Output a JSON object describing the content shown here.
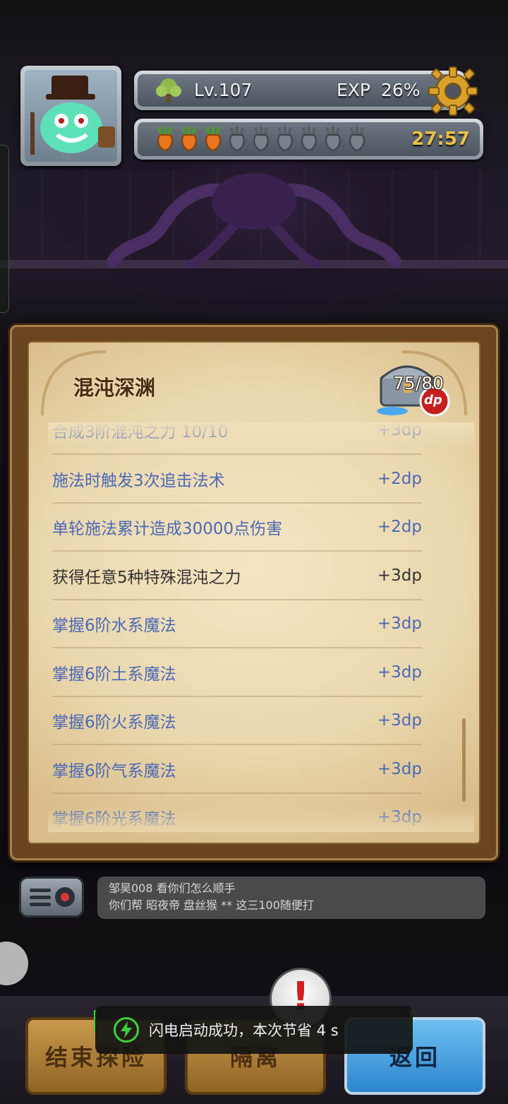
{
  "player": {
    "level": "Lv.107",
    "exp_label": "EXP",
    "exp_value": "26%",
    "stamina_total": 9,
    "stamina_filled": 3,
    "timer": "27:57"
  },
  "panel": {
    "title": "混沌深渊",
    "chest_count": "75/80",
    "chest_badge": "dp",
    "items": [
      {
        "name": "合成3阶混沌之力 10/10",
        "points": "+3dp",
        "done": false
      },
      {
        "name": "施法时触发3次追击法术",
        "points": "+2dp",
        "done": false
      },
      {
        "name": "单轮施法累计造成30000点伤害",
        "points": "+2dp",
        "done": false
      },
      {
        "name": "获得任意5种特殊混沌之力",
        "points": "+3dp",
        "done": true
      },
      {
        "name": "掌握6阶水系魔法",
        "points": "+3dp",
        "done": false
      },
      {
        "name": "掌握6阶土系魔法",
        "points": "+3dp",
        "done": false
      },
      {
        "name": "掌握6阶火系魔法",
        "points": "+3dp",
        "done": false
      },
      {
        "name": "掌握6阶气系魔法",
        "points": "+3dp",
        "done": false
      },
      {
        "name": "掌握6阶光系魔法",
        "points": "+3dp",
        "done": false
      }
    ]
  },
  "chat": {
    "sender": "邹昊008",
    "line1": "看你们怎么顺手",
    "line2": "你们帮  昭夜帝 盘丝猴 ** 这三100随便打"
  },
  "buttons": {
    "end": "结束探险",
    "isolate": "隔离",
    "back": "返回"
  },
  "toast": {
    "text": "闪电启动成功，本次节省 4 s"
  },
  "colors": {
    "task_pending": "#4b69b8",
    "task_done": "#333333",
    "timer": "#e9c14a",
    "back_button": "#2b86cf"
  }
}
